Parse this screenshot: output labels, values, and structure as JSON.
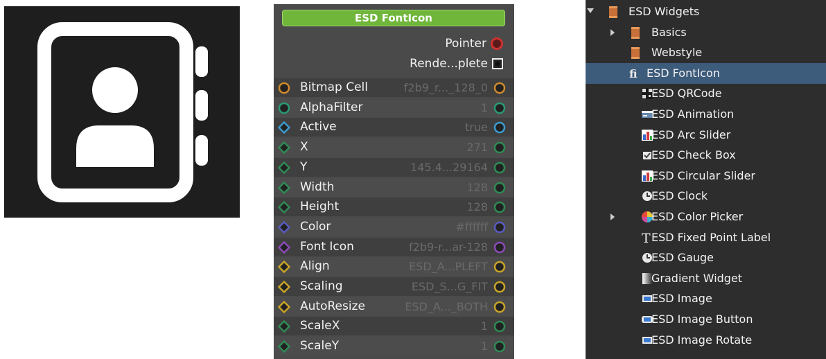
{
  "preview": {
    "icon": "contact-book-icon",
    "background": "#1e1e1e",
    "foreground": "#ffffff"
  },
  "node": {
    "title": "ESD FontIcon",
    "title_color": "#6fb63b",
    "outputs": [
      {
        "label": "Pointer",
        "pin": "circle-red"
      },
      {
        "label": "Rende...plete",
        "pin": "square"
      }
    ],
    "properties": [
      {
        "label": "Bitmap Cell",
        "value": "f2b9_r..._128_0",
        "color": "#d08a2a",
        "shape": "circle"
      },
      {
        "label": "AlphaFilter",
        "value": "1",
        "color": "#2a9a72",
        "shape": "circle"
      },
      {
        "label": "Active",
        "value": "true",
        "color": "#3a9ad0",
        "shape": "diamond"
      },
      {
        "label": "X",
        "value": "271",
        "color": "#2f8a55",
        "shape": "diamond"
      },
      {
        "label": "Y",
        "value": "145.4...29164",
        "color": "#2f8a55",
        "shape": "diamond"
      },
      {
        "label": "Width",
        "value": "128",
        "color": "#2f8a55",
        "shape": "diamond"
      },
      {
        "label": "Height",
        "value": "128",
        "color": "#2f8a55",
        "shape": "diamond"
      },
      {
        "label": "Color",
        "value": "#ffffff",
        "color": "#5a5ac0",
        "shape": "diamond"
      },
      {
        "label": "Font Icon",
        "value": "f2b9-r...ar-128",
        "color": "#8a4ab8",
        "shape": "diamond"
      },
      {
        "label": "Align",
        "value": "ESD_A...PLEFT",
        "color": "#c8a428",
        "shape": "diamond"
      },
      {
        "label": "Scaling",
        "value": "ESD_S...G_FIT",
        "color": "#c8a428",
        "shape": "diamond"
      },
      {
        "label": "AutoResize",
        "value": "ESD_A..._BOTH",
        "color": "#c8a428",
        "shape": "diamond"
      },
      {
        "label": "ScaleX",
        "value": "1",
        "color": "#2f8a55",
        "shape": "diamond"
      },
      {
        "label": "ScaleY",
        "value": "1",
        "color": "#2f8a55",
        "shape": "diamond"
      }
    ]
  },
  "tree": {
    "items": [
      {
        "label": "ESD Widgets",
        "icon": "book-icon",
        "level": 0,
        "arrow": "down",
        "selected": false
      },
      {
        "label": "Basics",
        "icon": "book-icon",
        "level": 1,
        "arrow": "right",
        "selected": false
      },
      {
        "label": "Webstyle",
        "icon": "book-icon",
        "level": 1,
        "arrow": "",
        "selected": false
      },
      {
        "label": "ESD FontIcon",
        "icon": "fonticon-icon",
        "level": 1,
        "arrow": "",
        "selected": true
      },
      {
        "label": "ESD QRCode",
        "icon": "qrcode-icon",
        "level": 2,
        "arrow": "",
        "selected": false
      },
      {
        "label": "ESD Animation",
        "icon": "animation-icon",
        "level": 2,
        "arrow": "",
        "selected": false
      },
      {
        "label": "ESD Arc Slider",
        "icon": "arc-slider-icon",
        "level": 2,
        "arrow": "",
        "selected": false
      },
      {
        "label": "ESD Check Box",
        "icon": "checkbox-icon",
        "level": 2,
        "arrow": "",
        "selected": false
      },
      {
        "label": "ESD Circular Slider",
        "icon": "circular-slider-icon",
        "level": 2,
        "arrow": "",
        "selected": false
      },
      {
        "label": "ESD Clock",
        "icon": "clock-icon",
        "level": 2,
        "arrow": "",
        "selected": false
      },
      {
        "label": "ESD Color Picker",
        "icon": "color-picker-icon",
        "level": 2,
        "arrow": "right",
        "selected": false
      },
      {
        "label": "ESD Fixed Point Label",
        "icon": "text-icon",
        "level": 2,
        "arrow": "",
        "selected": false
      },
      {
        "label": "ESD Gauge",
        "icon": "gauge-icon",
        "level": 2,
        "arrow": "",
        "selected": false
      },
      {
        "label": "Gradient Widget",
        "icon": "gradient-icon",
        "level": 2,
        "arrow": "",
        "selected": false
      },
      {
        "label": "ESD Image",
        "icon": "image-icon",
        "level": 2,
        "arrow": "",
        "selected": false
      },
      {
        "label": "ESD Image Button",
        "icon": "image-button-icon",
        "level": 2,
        "arrow": "",
        "selected": false
      },
      {
        "label": "ESD Image Rotate",
        "icon": "image-rotate-icon",
        "level": 2,
        "arrow": "",
        "selected": false
      }
    ]
  }
}
